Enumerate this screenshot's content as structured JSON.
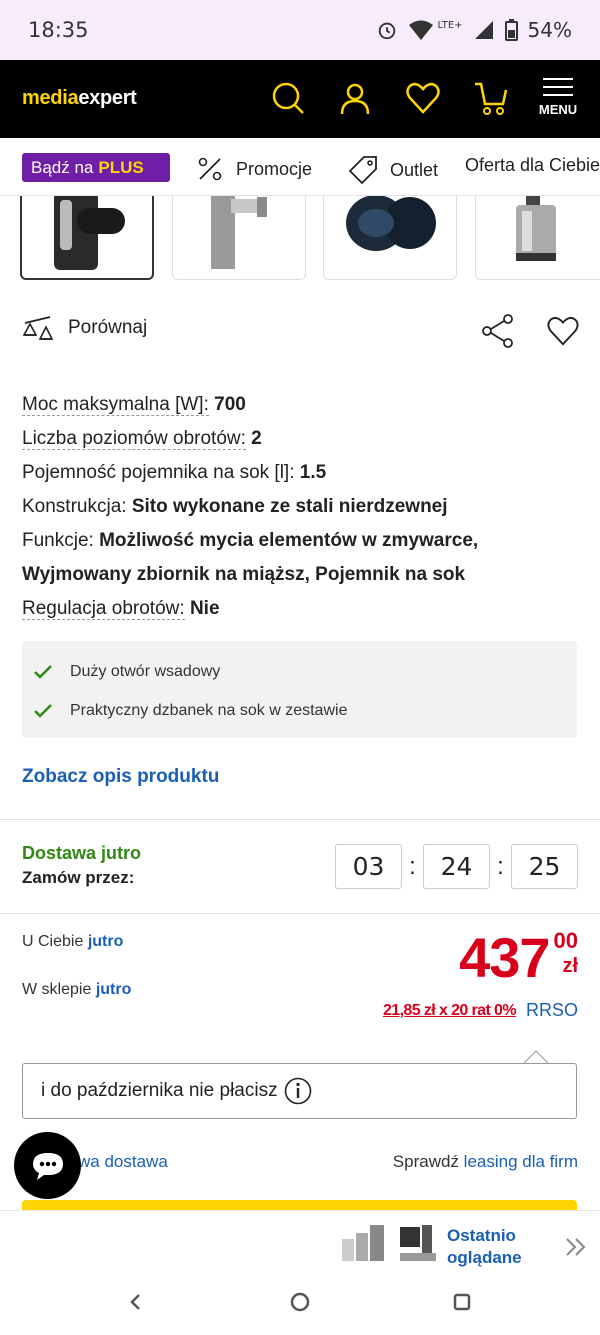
{
  "status_bar": {
    "time": "18:35",
    "network": "LTE+",
    "battery": "54%"
  },
  "header": {
    "logo_part1": "media",
    "logo_part2": "expert",
    "menu_label": "MENU"
  },
  "nav": {
    "plus_prefix": "Bądź na",
    "plus_word": "PLUS",
    "items": [
      "Promocje",
      "Outlet",
      "Oferta dla Ciebie"
    ]
  },
  "actions": {
    "compare_label": "Porównaj"
  },
  "specs": [
    {
      "key": "Moc maksymalna [W]:",
      "value": "700"
    },
    {
      "key": "Liczba poziomów obrotów:",
      "value": "2"
    },
    {
      "key": "Pojemność pojemnika na sok [l]:",
      "value": "1.5"
    },
    {
      "key": "Konstrukcja:",
      "value": "Sito wykonane ze stali nierdzewnej"
    },
    {
      "key": "Funkcje:",
      "value": "Możliwość mycia elementów w zmywarce,",
      "value2": "Wyjmowany zbiornik na miąższ, Pojemnik na sok"
    },
    {
      "key": "Regulacja obrotów:",
      "value": "Nie"
    }
  ],
  "features": [
    "Duży otwór wsadowy",
    "Praktyczny dzbanek na sok w zestawie"
  ],
  "see_description": "Zobacz opis produktu",
  "delivery": {
    "headline": "Dostawa jutro",
    "order_by": "Zamów przez:",
    "timer": {
      "hours": "03",
      "minutes": "24",
      "seconds": "25"
    }
  },
  "availability": {
    "home_label": "U Ciebie",
    "home_value": "jutro",
    "store_label": "W sklepie",
    "store_value": "jutro"
  },
  "price": {
    "main": "437",
    "cents": "00",
    "currency": "zł"
  },
  "installments": {
    "text": "21,85 zł x 20 rat 0%",
    "rrso": "RRSO"
  },
  "defer_text": "i do października nie płacisz",
  "bottom_links": {
    "left": "wa dostawa",
    "right_prefix": "Sprawdź",
    "right_link": "leasing dla firm"
  },
  "recently_viewed": {
    "line1": "Ostatnio",
    "line2": "oglądane"
  },
  "colors": {
    "brand_yellow": "#ffd400",
    "price_red": "#d9001b",
    "link_blue": "#1a5fb4",
    "green": "#2e8a14",
    "plus_purple": "#6f1fa6"
  }
}
